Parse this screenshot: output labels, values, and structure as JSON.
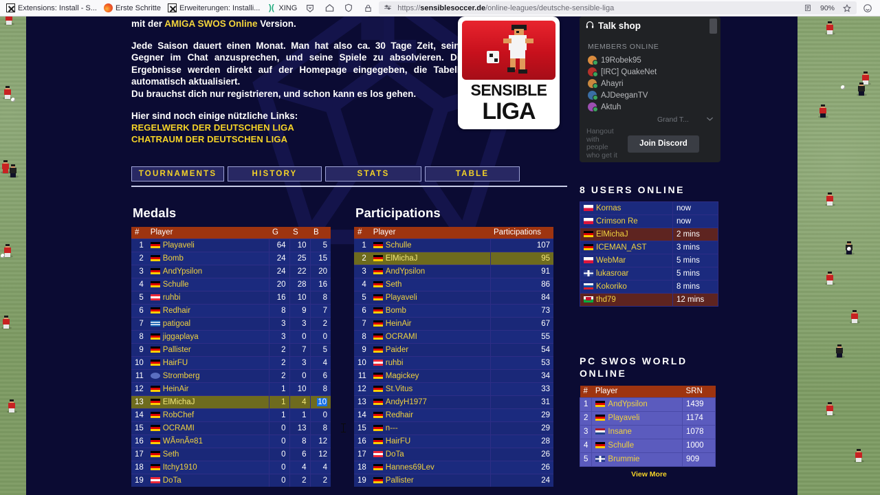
{
  "browser": {
    "bookmarks": [
      {
        "label": "Extensions: Install - S...",
        "icon": "puzzle-x-icon"
      },
      {
        "label": "Erste Schritte",
        "icon": "firefox-icon"
      },
      {
        "label": "Erweiterungen: Installi...",
        "icon": "puzzle-x-icon"
      },
      {
        "label": "XING",
        "icon": "xing-icon"
      }
    ],
    "url_prefix": "https://",
    "url_domain": "sensiblesoccer.de",
    "url_path": "/online-leagues/deutsche-sensible-liga",
    "zoom": "90%",
    "icons": [
      "pocket-icon",
      "home-icon",
      "shield-icon",
      "lock-icon",
      "permissions-icon",
      "reader-icon",
      "bookmark-star-icon",
      "account-icon"
    ]
  },
  "intro": {
    "line1_pre": "mit der ",
    "line1_hl": "AMIGA SWOS Online",
    "line1_post": " Version.",
    "para2": "Jede Saison dauert einen Monat.  Man hat also ca. 30 Tage Zeit, seine Gegner im Chat anzusprechen, und seine Spiele zu absolvieren. Die Ergebnisse werden direkt auf der Homepage eingegeben, die Tabelle automatisch aktualisiert.",
    "para3": "Du brauchst dich nur registrieren, und schon kann es los gehen.",
    "links_head": "Hier sind noch einige nützliche Links:",
    "link1": "REGELWERK DER DEUTSCHEN LIGA",
    "link2": "CHATRAUM DER DEUTSCHEN LIGA"
  },
  "logo": {
    "line1": "SENSIBLE",
    "line2": "LIGA"
  },
  "tabs": [
    {
      "label": "TOURNAMENTS"
    },
    {
      "label": "HISTORY"
    },
    {
      "label": "STATS"
    },
    {
      "label": "TABLE"
    }
  ],
  "medals": {
    "title": "Medals",
    "headers": {
      "rank": "#",
      "player": "Player",
      "g": "G",
      "s": "S",
      "b": "B"
    },
    "rows": [
      {
        "rank": 1,
        "flag": "de",
        "player": "Playaveli",
        "g": "64",
        "s": "10",
        "b": "5"
      },
      {
        "rank": 2,
        "flag": "de",
        "player": "Bomb",
        "g": "24",
        "s": "25",
        "b": "15"
      },
      {
        "rank": 3,
        "flag": "de",
        "player": "AndYpsilon",
        "g": "24",
        "s": "22",
        "b": "20"
      },
      {
        "rank": 4,
        "flag": "de",
        "player": "Schulle",
        "g": "20",
        "s": "28",
        "b": "16"
      },
      {
        "rank": 5,
        "flag": "at",
        "player": "ruhbi",
        "g": "16",
        "s": "10",
        "b": "8"
      },
      {
        "rank": 6,
        "flag": "de",
        "player": "Redhair",
        "g": "8",
        "s": "9",
        "b": "7"
      },
      {
        "rank": 7,
        "flag": "gr",
        "player": "patigoal",
        "g": "3",
        "s": "3",
        "b": "2"
      },
      {
        "rank": 8,
        "flag": "de",
        "player": "jiggaplaya",
        "g": "3",
        "s": "0",
        "b": "0"
      },
      {
        "rank": 9,
        "flag": "de",
        "player": "Pallister",
        "g": "2",
        "s": "7",
        "b": "5"
      },
      {
        "rank": 10,
        "flag": "de",
        "player": "HairFU",
        "g": "2",
        "s": "3",
        "b": "4"
      },
      {
        "rank": 11,
        "flag": "generic",
        "player": "Stromberg",
        "g": "2",
        "s": "0",
        "b": "6"
      },
      {
        "rank": 12,
        "flag": "de",
        "player": "HeinAir",
        "g": "1",
        "s": "10",
        "b": "8"
      },
      {
        "rank": 13,
        "flag": "de",
        "player": "ElMichaJ",
        "g": "1",
        "s": "4",
        "b": "10",
        "highlight": true,
        "b_selected": true
      },
      {
        "rank": 14,
        "flag": "de",
        "player": "RobChef",
        "g": "1",
        "s": "1",
        "b": "0"
      },
      {
        "rank": 15,
        "flag": "de",
        "player": "OCRAMI",
        "g": "0",
        "s": "13",
        "b": "8"
      },
      {
        "rank": 16,
        "flag": "de",
        "player": "WÃ¤nÃ¤81",
        "g": "0",
        "s": "8",
        "b": "12"
      },
      {
        "rank": 17,
        "flag": "de",
        "player": "Seth",
        "g": "0",
        "s": "6",
        "b": "12"
      },
      {
        "rank": 18,
        "flag": "de",
        "player": "Itchy1910",
        "g": "0",
        "s": "4",
        "b": "4"
      },
      {
        "rank": 19,
        "flag": "at",
        "player": "DoTa",
        "g": "0",
        "s": "2",
        "b": "2"
      }
    ]
  },
  "participations": {
    "title": "Participations",
    "headers": {
      "rank": "#",
      "player": "Player",
      "count": "Participations"
    },
    "rows": [
      {
        "rank": 1,
        "flag": "de",
        "player": "Schulle",
        "count": "107"
      },
      {
        "rank": 2,
        "flag": "de",
        "player": "ElMichaJ",
        "count": "95",
        "highlight": true
      },
      {
        "rank": 3,
        "flag": "de",
        "player": "AndYpsilon",
        "count": "91"
      },
      {
        "rank": 4,
        "flag": "de",
        "player": "Seth",
        "count": "86"
      },
      {
        "rank": 5,
        "flag": "de",
        "player": "Playaveli",
        "count": "84"
      },
      {
        "rank": 6,
        "flag": "de",
        "player": "Bomb",
        "count": "73"
      },
      {
        "rank": 7,
        "flag": "de",
        "player": "HeinAir",
        "count": "67"
      },
      {
        "rank": 8,
        "flag": "de",
        "player": "OCRAMI",
        "count": "55"
      },
      {
        "rank": 9,
        "flag": "de",
        "player": "Paider",
        "count": "54"
      },
      {
        "rank": 10,
        "flag": "at",
        "player": "ruhbi",
        "count": "53"
      },
      {
        "rank": 11,
        "flag": "de",
        "player": "Magickey",
        "count": "34"
      },
      {
        "rank": 12,
        "flag": "de",
        "player": "St.Vitus",
        "count": "33"
      },
      {
        "rank": 13,
        "flag": "de",
        "player": "AndyH1977",
        "count": "31"
      },
      {
        "rank": 14,
        "flag": "de",
        "player": "Redhair",
        "count": "29"
      },
      {
        "rank": 15,
        "flag": "de",
        "player": "n---",
        "count": "29"
      },
      {
        "rank": 16,
        "flag": "de",
        "player": "HairFU",
        "count": "28"
      },
      {
        "rank": 17,
        "flag": "at",
        "player": "DoTa",
        "count": "26"
      },
      {
        "rank": 18,
        "flag": "de",
        "player": "Hannes69Lev",
        "count": "26"
      },
      {
        "rank": 19,
        "flag": "de",
        "player": "Pallister",
        "count": "24"
      }
    ]
  },
  "discord": {
    "title": "Talk shop",
    "members_label": "MEMBERS ONLINE",
    "members": [
      "19Robek95",
      "[IRC] QuakeNet",
      "Ahayri",
      "AJDeeganTV",
      "Aktuh"
    ],
    "selected_game": "Grand T...",
    "tagline": "Hangout with people who get it",
    "join_label": "Join Discord"
  },
  "users_online": {
    "title": "8 USERS ONLINE",
    "rows": [
      {
        "flag": "pl",
        "name": "Kornas",
        "time": "now",
        "warm": false
      },
      {
        "flag": "pl",
        "name": "Crimson Re",
        "time": "now",
        "warm": false
      },
      {
        "flag": "de",
        "name": "ElMichaJ",
        "time": "2 mins",
        "warm": true
      },
      {
        "flag": "de",
        "name": "ICEMAN_AST",
        "time": "3 mins",
        "warm": false
      },
      {
        "flag": "pl",
        "name": "WebMar",
        "time": "5 mins",
        "warm": false
      },
      {
        "flag": "gb",
        "name": "lukasroar",
        "time": "5 mins",
        "warm": false
      },
      {
        "flag": "si",
        "name": "Kokoriko",
        "time": "8 mins",
        "warm": false
      },
      {
        "flag": "wales",
        "name": "thd79",
        "time": "12 mins",
        "warm": true
      }
    ]
  },
  "pcswos": {
    "title": "PC SWOS WORLD ONLINE",
    "headers": {
      "rank": "#",
      "player": "Player",
      "srn": "SRN"
    },
    "rows": [
      {
        "rank": 1,
        "flag": "de",
        "player": "AndYpsilon",
        "srn": "1439"
      },
      {
        "rank": 2,
        "flag": "de",
        "player": "Playaveli",
        "srn": "1174"
      },
      {
        "rank": 3,
        "flag": "nl",
        "player": "Insane",
        "srn": "1078"
      },
      {
        "rank": 4,
        "flag": "de",
        "player": "Schulle",
        "srn": "1000"
      },
      {
        "rank": 5,
        "flag": "gb",
        "player": "Brummie",
        "srn": "909"
      }
    ],
    "view_more": "View More"
  },
  "colors": {
    "page_bg": "#0b0b33",
    "pitch": "#7d9b63",
    "table_header": "#9e3410",
    "table_row": "#1b2a7e",
    "accent_yellow": "#f0d23f",
    "highlight_row": "#6e6b1e",
    "selection_blue": "#1a73e8"
  }
}
